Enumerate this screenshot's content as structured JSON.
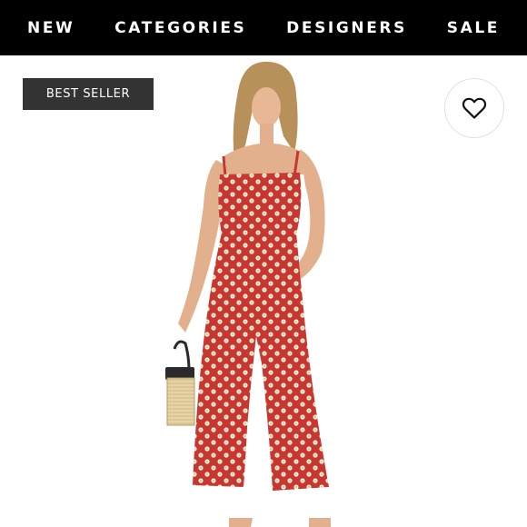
{
  "nav": {
    "items": [
      {
        "label": "NEW"
      },
      {
        "label": "CATEGORIES"
      },
      {
        "label": "DESIGNERS"
      },
      {
        "label": "SALE"
      }
    ]
  },
  "product": {
    "badge": "BEST SELLER",
    "favorite_icon": "heart-outline-icon",
    "image_subject": "model-in-red-floral-jumpsuit"
  },
  "colors": {
    "nav_bg": "#000000",
    "nav_text": "#ffffff",
    "badge_bg": "#333333",
    "garment": "#c8372f"
  }
}
